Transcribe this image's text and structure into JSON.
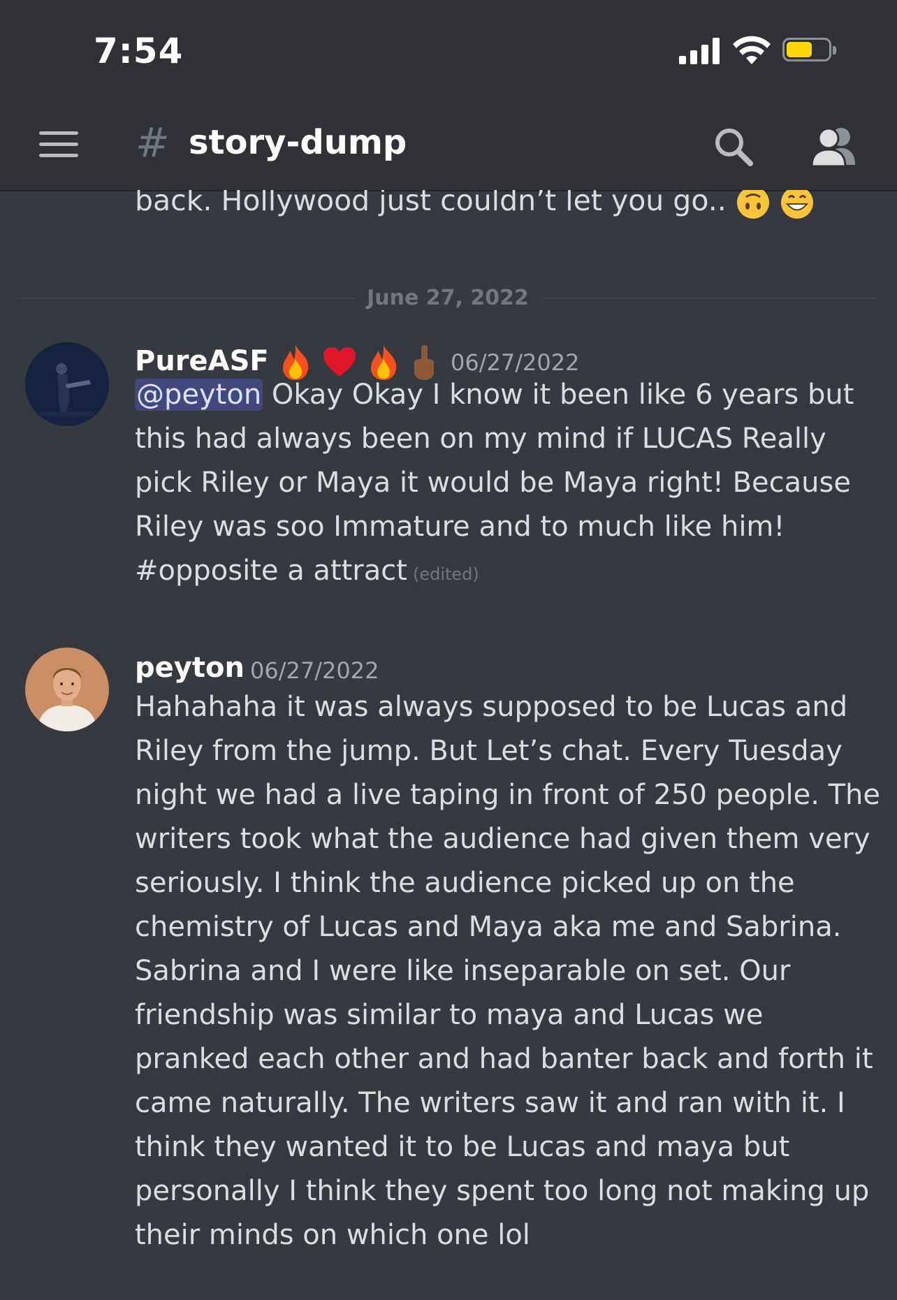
{
  "status_bar": {
    "time": "7:54"
  },
  "header": {
    "channel_hash": "#",
    "channel_name": "story-dump",
    "icons": [
      "menu-icon",
      "search-icon",
      "members-icon"
    ]
  },
  "previous_message": {
    "text": "back. Hollywood just couldn’t let you go.."
  },
  "date_divider": "June 27, 2022",
  "messages": [
    {
      "username": "PureASF",
      "timestamp": "06/27/2022",
      "mention": "@peyton",
      "text": " Okay Okay I know it been like 6 years but this had always been on my mind if LUCAS Really pick Riley or Maya it would be Maya right! Because Riley was soo Immature and to much like him! #opposite a attract",
      "edited": "(edited)"
    },
    {
      "username": "peyton",
      "timestamp": "06/27/2022",
      "text": "Hahahaha it was always supposed to be Lucas and Riley from the jump. But Let’s chat. Every Tuesday night we had a live taping in front of 250 people. The writers took what the audience had given them very seriously. I think the audience picked up on the chemistry of Lucas and Maya aka me and Sabrina. Sabrina and I were like inseparable on set. Our friendship was similar to maya and Lucas we pranked each other and had banter back and forth it came naturally. The writers saw it and ran with it. I think they wanted it to be Lucas and maya but personally I think they spent too long not making up their minds on which one lol"
    }
  ],
  "colors": {
    "background": "#36393f",
    "header_bg": "#2f3136",
    "mention_bg": "#3f4478",
    "battery": "#ffd60a"
  }
}
